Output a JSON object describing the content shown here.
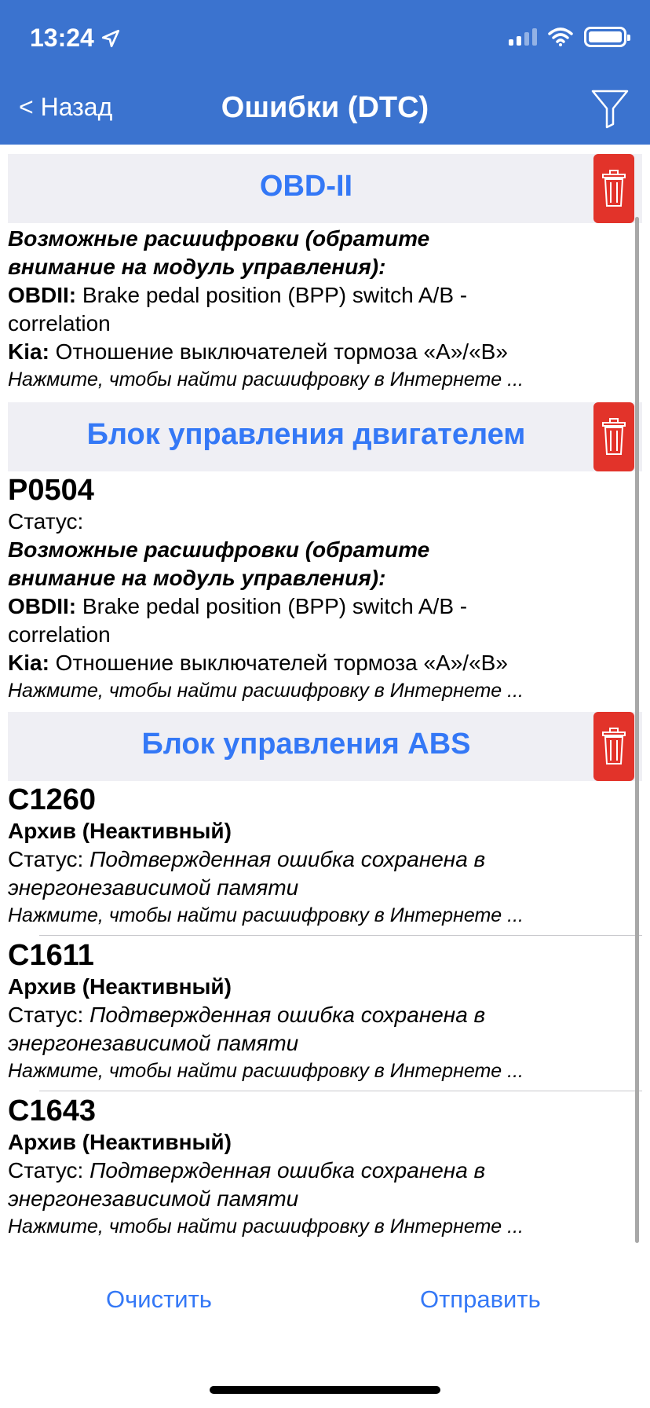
{
  "status_bar": {
    "time": "13:24"
  },
  "nav": {
    "back_label": "< Назад",
    "title": "Ошибки (DTC)"
  },
  "sections": {
    "obd": {
      "title": "OBD-II",
      "entry": {
        "hint_label": "Возможные расшифровки (обратите внимание на модуль управления):",
        "obdii_key": "OBDII:",
        "obdii_value": " Brake pedal position (BPP) switch A/B - correlation",
        "kia_key": "Kia:",
        "kia_value": " Отношение выключателей тормоза «A»/«B»",
        "search": "Нажмите, чтобы найти расшифровку в Интернете ..."
      }
    },
    "engine": {
      "title": "Блок управления двигателем",
      "entry": {
        "code": "P0504",
        "status_label": "Статус:",
        "hint_label": "Возможные расшифровки (обратите внимание на модуль управления):",
        "obdii_key": "OBDII:",
        "obdii_value": " Brake pedal position (BPP) switch A/B - correlation",
        "kia_key": "Kia:",
        "kia_value": " Отношение выключателей тормоза «A»/«B»",
        "search": "Нажмите, чтобы найти расшифровку в Интернете ..."
      }
    },
    "abs": {
      "title": "Блок управления ABS",
      "entries": [
        {
          "code": "C1260",
          "archive": "Архив (Неактивный)",
          "status_label": "Статус: ",
          "status_value": "Подтвержденная ошибка сохранена в энергонезависимой памяти",
          "search": "Нажмите, чтобы найти расшифровку в Интернете ..."
        },
        {
          "code": "C1611",
          "archive": "Архив (Неактивный)",
          "status_label": "Статус: ",
          "status_value": "Подтвержденная ошибка сохранена в энергонезависимой памяти",
          "search": "Нажмите, чтобы найти расшифровку в Интернете ..."
        },
        {
          "code": "C1643",
          "archive": "Архив (Неактивный)",
          "status_label": "Статус: ",
          "status_value": "Подтвержденная ошибка сохранена в энергонезависимой памяти",
          "search": "Нажмите, чтобы найти расшифровку в Интернете ..."
        }
      ]
    }
  },
  "bottom": {
    "clear_label": "Очистить",
    "send_label": "Отправить"
  },
  "colors": {
    "nav_bg": "#3b73cf",
    "accent": "#3478f6",
    "delete": "#e2332a",
    "section_bg": "#efeff4"
  },
  "icons": [
    "location-arrow-icon",
    "signal-icon",
    "wifi-icon",
    "battery-icon",
    "filter-icon",
    "trash-icon"
  ]
}
